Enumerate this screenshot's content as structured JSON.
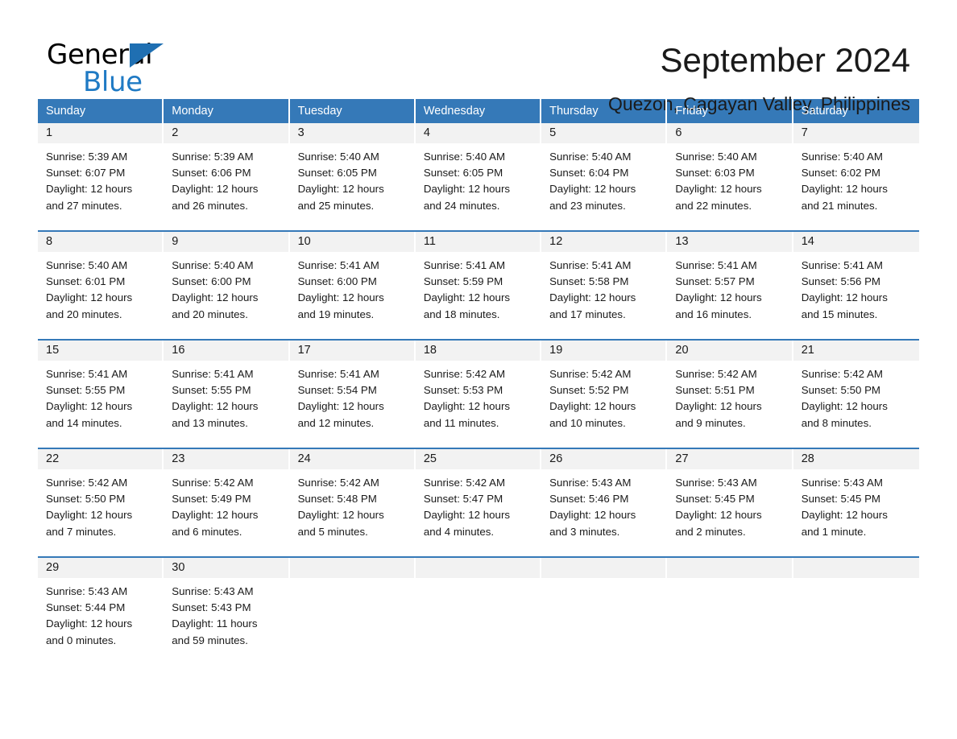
{
  "logo": {
    "word_one": "General",
    "word_two": "Blue",
    "triangle_icon": "blue-triangle-icon",
    "accent_color": "#1F7AC4"
  },
  "header": {
    "month_title": "September 2024",
    "location": "Quezon, Cagayan Valley, Philippines"
  },
  "calendar": {
    "header_color": "#3579B8",
    "daynum_band_color": "#F2F2F2",
    "weekdays": [
      "Sunday",
      "Monday",
      "Tuesday",
      "Wednesday",
      "Thursday",
      "Friday",
      "Saturday"
    ],
    "weeks": [
      [
        {
          "day": "1",
          "sunrise": "Sunrise: 5:39 AM",
          "sunset": "Sunset: 6:07 PM",
          "daylight_1": "Daylight: 12 hours",
          "daylight_2": "and 27 minutes."
        },
        {
          "day": "2",
          "sunrise": "Sunrise: 5:39 AM",
          "sunset": "Sunset: 6:06 PM",
          "daylight_1": "Daylight: 12 hours",
          "daylight_2": "and 26 minutes."
        },
        {
          "day": "3",
          "sunrise": "Sunrise: 5:40 AM",
          "sunset": "Sunset: 6:05 PM",
          "daylight_1": "Daylight: 12 hours",
          "daylight_2": "and 25 minutes."
        },
        {
          "day": "4",
          "sunrise": "Sunrise: 5:40 AM",
          "sunset": "Sunset: 6:05 PM",
          "daylight_1": "Daylight: 12 hours",
          "daylight_2": "and 24 minutes."
        },
        {
          "day": "5",
          "sunrise": "Sunrise: 5:40 AM",
          "sunset": "Sunset: 6:04 PM",
          "daylight_1": "Daylight: 12 hours",
          "daylight_2": "and 23 minutes."
        },
        {
          "day": "6",
          "sunrise": "Sunrise: 5:40 AM",
          "sunset": "Sunset: 6:03 PM",
          "daylight_1": "Daylight: 12 hours",
          "daylight_2": "and 22 minutes."
        },
        {
          "day": "7",
          "sunrise": "Sunrise: 5:40 AM",
          "sunset": "Sunset: 6:02 PM",
          "daylight_1": "Daylight: 12 hours",
          "daylight_2": "and 21 minutes."
        }
      ],
      [
        {
          "day": "8",
          "sunrise": "Sunrise: 5:40 AM",
          "sunset": "Sunset: 6:01 PM",
          "daylight_1": "Daylight: 12 hours",
          "daylight_2": "and 20 minutes."
        },
        {
          "day": "9",
          "sunrise": "Sunrise: 5:40 AM",
          "sunset": "Sunset: 6:00 PM",
          "daylight_1": "Daylight: 12 hours",
          "daylight_2": "and 20 minutes."
        },
        {
          "day": "10",
          "sunrise": "Sunrise: 5:41 AM",
          "sunset": "Sunset: 6:00 PM",
          "daylight_1": "Daylight: 12 hours",
          "daylight_2": "and 19 minutes."
        },
        {
          "day": "11",
          "sunrise": "Sunrise: 5:41 AM",
          "sunset": "Sunset: 5:59 PM",
          "daylight_1": "Daylight: 12 hours",
          "daylight_2": "and 18 minutes."
        },
        {
          "day": "12",
          "sunrise": "Sunrise: 5:41 AM",
          "sunset": "Sunset: 5:58 PM",
          "daylight_1": "Daylight: 12 hours",
          "daylight_2": "and 17 minutes."
        },
        {
          "day": "13",
          "sunrise": "Sunrise: 5:41 AM",
          "sunset": "Sunset: 5:57 PM",
          "daylight_1": "Daylight: 12 hours",
          "daylight_2": "and 16 minutes."
        },
        {
          "day": "14",
          "sunrise": "Sunrise: 5:41 AM",
          "sunset": "Sunset: 5:56 PM",
          "daylight_1": "Daylight: 12 hours",
          "daylight_2": "and 15 minutes."
        }
      ],
      [
        {
          "day": "15",
          "sunrise": "Sunrise: 5:41 AM",
          "sunset": "Sunset: 5:55 PM",
          "daylight_1": "Daylight: 12 hours",
          "daylight_2": "and 14 minutes."
        },
        {
          "day": "16",
          "sunrise": "Sunrise: 5:41 AM",
          "sunset": "Sunset: 5:55 PM",
          "daylight_1": "Daylight: 12 hours",
          "daylight_2": "and 13 minutes."
        },
        {
          "day": "17",
          "sunrise": "Sunrise: 5:41 AM",
          "sunset": "Sunset: 5:54 PM",
          "daylight_1": "Daylight: 12 hours",
          "daylight_2": "and 12 minutes."
        },
        {
          "day": "18",
          "sunrise": "Sunrise: 5:42 AM",
          "sunset": "Sunset: 5:53 PM",
          "daylight_1": "Daylight: 12 hours",
          "daylight_2": "and 11 minutes."
        },
        {
          "day": "19",
          "sunrise": "Sunrise: 5:42 AM",
          "sunset": "Sunset: 5:52 PM",
          "daylight_1": "Daylight: 12 hours",
          "daylight_2": "and 10 minutes."
        },
        {
          "day": "20",
          "sunrise": "Sunrise: 5:42 AM",
          "sunset": "Sunset: 5:51 PM",
          "daylight_1": "Daylight: 12 hours",
          "daylight_2": "and 9 minutes."
        },
        {
          "day": "21",
          "sunrise": "Sunrise: 5:42 AM",
          "sunset": "Sunset: 5:50 PM",
          "daylight_1": "Daylight: 12 hours",
          "daylight_2": "and 8 minutes."
        }
      ],
      [
        {
          "day": "22",
          "sunrise": "Sunrise: 5:42 AM",
          "sunset": "Sunset: 5:50 PM",
          "daylight_1": "Daylight: 12 hours",
          "daylight_2": "and 7 minutes."
        },
        {
          "day": "23",
          "sunrise": "Sunrise: 5:42 AM",
          "sunset": "Sunset: 5:49 PM",
          "daylight_1": "Daylight: 12 hours",
          "daylight_2": "and 6 minutes."
        },
        {
          "day": "24",
          "sunrise": "Sunrise: 5:42 AM",
          "sunset": "Sunset: 5:48 PM",
          "daylight_1": "Daylight: 12 hours",
          "daylight_2": "and 5 minutes."
        },
        {
          "day": "25",
          "sunrise": "Sunrise: 5:42 AM",
          "sunset": "Sunset: 5:47 PM",
          "daylight_1": "Daylight: 12 hours",
          "daylight_2": "and 4 minutes."
        },
        {
          "day": "26",
          "sunrise": "Sunrise: 5:43 AM",
          "sunset": "Sunset: 5:46 PM",
          "daylight_1": "Daylight: 12 hours",
          "daylight_2": "and 3 minutes."
        },
        {
          "day": "27",
          "sunrise": "Sunrise: 5:43 AM",
          "sunset": "Sunset: 5:45 PM",
          "daylight_1": "Daylight: 12 hours",
          "daylight_2": "and 2 minutes."
        },
        {
          "day": "28",
          "sunrise": "Sunrise: 5:43 AM",
          "sunset": "Sunset: 5:45 PM",
          "daylight_1": "Daylight: 12 hours",
          "daylight_2": "and 1 minute."
        }
      ],
      [
        {
          "day": "29",
          "sunrise": "Sunrise: 5:43 AM",
          "sunset": "Sunset: 5:44 PM",
          "daylight_1": "Daylight: 12 hours",
          "daylight_2": "and 0 minutes."
        },
        {
          "day": "30",
          "sunrise": "Sunrise: 5:43 AM",
          "sunset": "Sunset: 5:43 PM",
          "daylight_1": "Daylight: 11 hours",
          "daylight_2": "and 59 minutes."
        },
        {
          "day": "",
          "sunrise": "",
          "sunset": "",
          "daylight_1": "",
          "daylight_2": ""
        },
        {
          "day": "",
          "sunrise": "",
          "sunset": "",
          "daylight_1": "",
          "daylight_2": ""
        },
        {
          "day": "",
          "sunrise": "",
          "sunset": "",
          "daylight_1": "",
          "daylight_2": ""
        },
        {
          "day": "",
          "sunrise": "",
          "sunset": "",
          "daylight_1": "",
          "daylight_2": ""
        },
        {
          "day": "",
          "sunrise": "",
          "sunset": "",
          "daylight_1": "",
          "daylight_2": ""
        }
      ]
    ]
  }
}
